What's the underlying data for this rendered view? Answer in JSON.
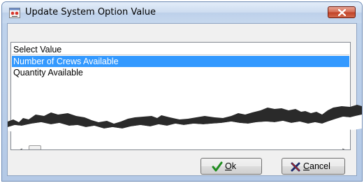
{
  "window": {
    "title": "Update System Option Value",
    "app_icon": "app-options-icon",
    "close_icon": "close-icon"
  },
  "list": {
    "header": "Select Value",
    "items": [
      {
        "label": "Number of Crews Available",
        "selected": true
      },
      {
        "label": "Quantity Available",
        "selected": false
      }
    ]
  },
  "scrollbar": {
    "left_arrow": "scroll-left-arrow-icon",
    "right_arrow": "scroll-right-arrow-icon"
  },
  "buttons": {
    "ok": {
      "mnemonic": "O",
      "rest": "k",
      "icon": "checkmark-icon"
    },
    "cancel": {
      "mnemonic": "C",
      "rest": "ancel",
      "icon": "x-icon"
    }
  },
  "colors": {
    "selection": "#3399ff",
    "ok_check": "#1e8c1e",
    "cancel_x": "#1a2a6c"
  }
}
